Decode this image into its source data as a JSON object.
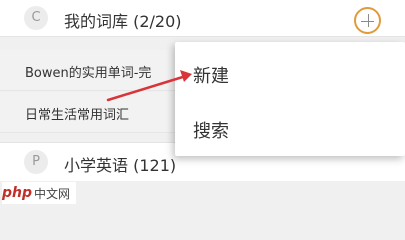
{
  "header": {
    "avatar_letter": "C",
    "title": "我的词库 (2/20)"
  },
  "lists": [
    {
      "label": "Bowen的实用单词-完"
    },
    {
      "label": "日常生活常用词汇"
    }
  ],
  "bottom": {
    "avatar_letter": "P",
    "title": "小学英语 (121)"
  },
  "popup": {
    "new_label": "新建",
    "search_label": "搜索"
  },
  "annotation": {
    "arrow_color": "#d8353a",
    "highlight_color": "#e29a3a"
  },
  "watermark": {
    "logo": "php",
    "text": "中文网"
  }
}
